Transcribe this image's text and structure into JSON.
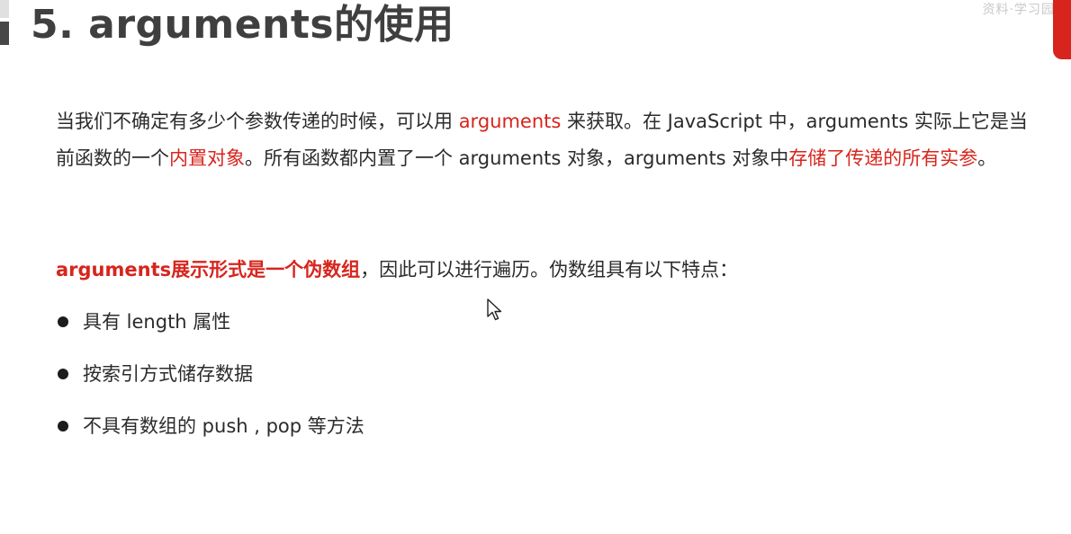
{
  "slide": {
    "title": "5. arguments的使用",
    "corner_watermark": "资料·学习园"
  },
  "paragraph1": {
    "s1": "当我们不确定有多少个参数传递的时候，可以用 ",
    "s2": "arguments",
    "s3": " 来获取。在 JavaScript 中，arguments 实际上它是当前函数的一个",
    "s4": "内置对象",
    "s5": "。所有函数都内置了一个 arguments 对象，arguments 对象中",
    "s6": "存储了传递的所有实参",
    "s7": "。"
  },
  "paragraph2": {
    "s1": "arguments展示形式是一个伪数组",
    "s2": "，因此可以进行遍历。伪数组具有以下特点："
  },
  "bullets": [
    {
      "text": "具有 length 属性"
    },
    {
      "text": "按索引方式储存数据"
    },
    {
      "text": "不具有数组的 push , pop 等方法"
    }
  ],
  "colors": {
    "accent_red": "#d7251d",
    "title_gray": "#3f3f3f",
    "body_text": "#2b2b2b"
  },
  "icons": {
    "bullet": "filled-circle",
    "cursor": "mouse-pointer-icon"
  }
}
